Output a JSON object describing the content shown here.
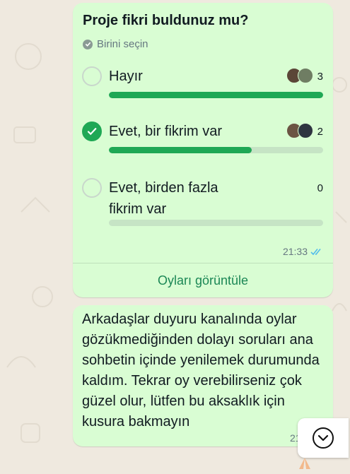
{
  "poll": {
    "question": "Proje fikri buldunuz mu?",
    "hint": "Birini seçin",
    "options": [
      {
        "label": "Hayır",
        "votes": "3",
        "fraction": 1.0,
        "selected": false
      },
      {
        "label": "Evet, bir fikrim var",
        "votes": "2",
        "fraction": 0.667,
        "selected": true
      },
      {
        "label": "Evet, birden fazla fikrim var",
        "votes": "0",
        "fraction": 0.0,
        "selected": false
      }
    ],
    "time": "21:33",
    "view_votes": "Oyları görüntüle"
  },
  "message": {
    "text": "Arkadaşlar duyuru kanalında oylar gözükmediğinden dolayı soruları ana sohbetin içinde yenilemek durumunda kaldım. Tekrar oy verebilirseniz çok güzel olur, lütfen bu aksaklık için kusura bakmayın",
    "time": "21:33"
  },
  "colors": {
    "accent": "#1fa855",
    "bubble": "#d9fdd3",
    "read_ticks": "#53bdeb"
  },
  "icons": {
    "read": "double-check-icon",
    "scroll": "chevron-down-icon",
    "reaction": "praying-hands-icon"
  }
}
